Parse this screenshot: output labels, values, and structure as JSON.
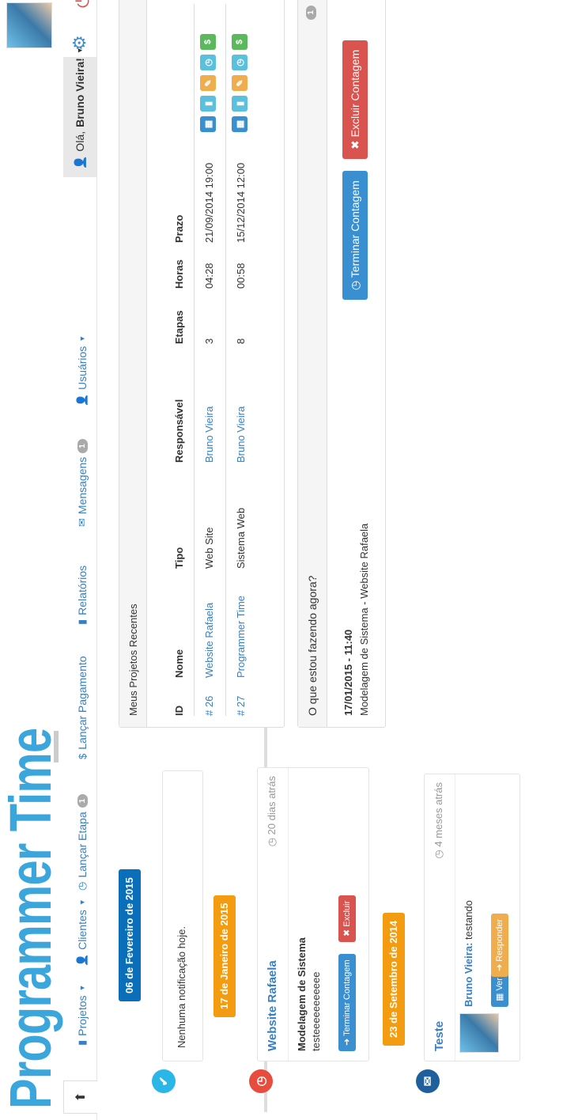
{
  "brand": {
    "title": "Programmer Time"
  },
  "nav": {
    "projetos": "Projetos",
    "clientes": "Clientes",
    "lancar_etapa": "Lançar Etapa",
    "lancar_etapa_badge": "1",
    "lancar_pagamento": "Lançar Pagamento",
    "relatorios": "Relatórios",
    "mensagens": "Mensagens",
    "mensagens_badge": "1",
    "usuarios": "Usuários"
  },
  "user": {
    "greeting": "Olá,",
    "name": "Bruno Vieira!"
  },
  "timeline": {
    "events": [
      {
        "date": "06 de Fevereiro de 2015",
        "color": "#0a6fb8",
        "node_color": "#2ab7e8",
        "body": "Nenhuma notificação hoje."
      },
      {
        "date": "17 de Janeiro de 2015",
        "color": "#f39c12",
        "node_color": "#e74c3c",
        "title": "Website Rafaela",
        "time": "20 dias atrás",
        "subtitle": "Modelagem de Sistema",
        "text": "testeeeeeeeeeee",
        "btn_primary": "Terminar Contagem",
        "btn_danger": "Excluir"
      },
      {
        "date": "23 de Setembro de 2014",
        "color": "#f39c12",
        "node_color": "#1f5f9b",
        "title": "Teste",
        "time": "4 meses atrás",
        "author": "Bruno Vieira:",
        "message": "testando",
        "btn_view": "Ver",
        "btn_reply": "Responder"
      }
    ]
  },
  "projects": {
    "heading": "Meus Projetos Recentes",
    "columns": [
      "ID",
      "Nome",
      "Tipo",
      "Responsável",
      "Etapas",
      "Horas",
      "Prazo"
    ],
    "rows": [
      {
        "id": "# 26",
        "nome": "Website Rafaela",
        "tipo": "Web Site",
        "responsavel": "Bruno Vieira",
        "etapas": "3",
        "horas": "04:28",
        "prazo": "21/09/2014 19:00"
      },
      {
        "id": "# 27",
        "nome": "Programmer Time",
        "tipo": "Sistema Web",
        "responsavel": "Bruno Vieira",
        "etapas": "8",
        "horas": "00:58",
        "prazo": "15/12/2014 12:00"
      }
    ]
  },
  "now": {
    "heading": "O que estou fazendo agora?",
    "badge": "1",
    "datetime": "17/01/2015 - 11:40",
    "task": "Modelagem de Sistema - Website Rafaela",
    "btn_stop": "Terminar Contagem",
    "btn_delete": "Excluir Contagem"
  },
  "colors": {
    "accent": "#3aa6dc",
    "link": "#3a7fc1",
    "danger": "#d9534f",
    "warning": "#f0ad4e",
    "info": "#5bc0de",
    "success": "#5cb85c"
  }
}
